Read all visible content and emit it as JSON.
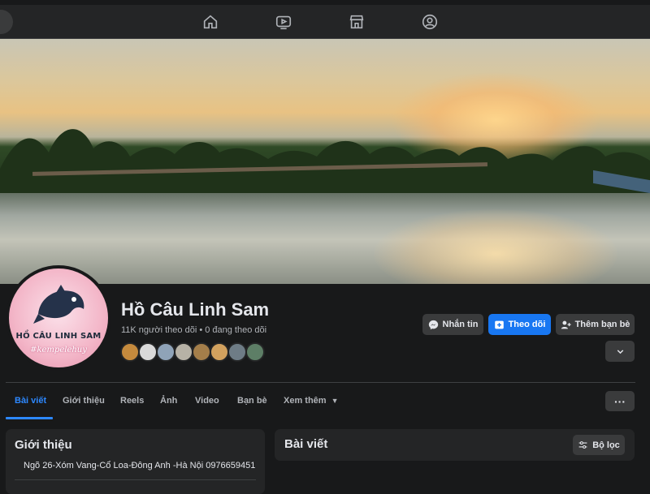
{
  "topbar": {
    "icons": [
      "home-icon",
      "video-icon",
      "marketplace-icon",
      "groups-icon"
    ]
  },
  "profile": {
    "name": "Hồ Câu Linh Sam",
    "stats": "11K người theo dõi • 0 đang theo dõi",
    "avatar_text": "HỒ CÂU LINH SAM",
    "avatar_script": "#kempelehuy",
    "friend_count_shown": 8
  },
  "actions": {
    "message_label": "Nhắn tin",
    "follow_label": "Theo dõi",
    "add_friend_label": "Thêm bạn bè"
  },
  "tabs": [
    {
      "label": "Bài viết",
      "active": true
    },
    {
      "label": "Giới thiệu",
      "active": false
    },
    {
      "label": "Reels",
      "active": false
    },
    {
      "label": "Ảnh",
      "active": false
    },
    {
      "label": "Video",
      "active": false
    },
    {
      "label": "Bạn bè",
      "active": false
    },
    {
      "label": "Xem thêm",
      "active": false
    }
  ],
  "intro": {
    "title": "Giới thiệu",
    "address": "Ngõ 26-Xóm Vang-Cổ Loa-Đông Anh -Hà Nội 0976659451"
  },
  "posts": {
    "title": "Bài viết",
    "filter_label": "Bộ lọc"
  },
  "colors": {
    "background": "#18191a",
    "surface": "#242526",
    "accent": "#1877f2",
    "text": "#e4e6eb",
    "muted": "#b0b3b8"
  }
}
